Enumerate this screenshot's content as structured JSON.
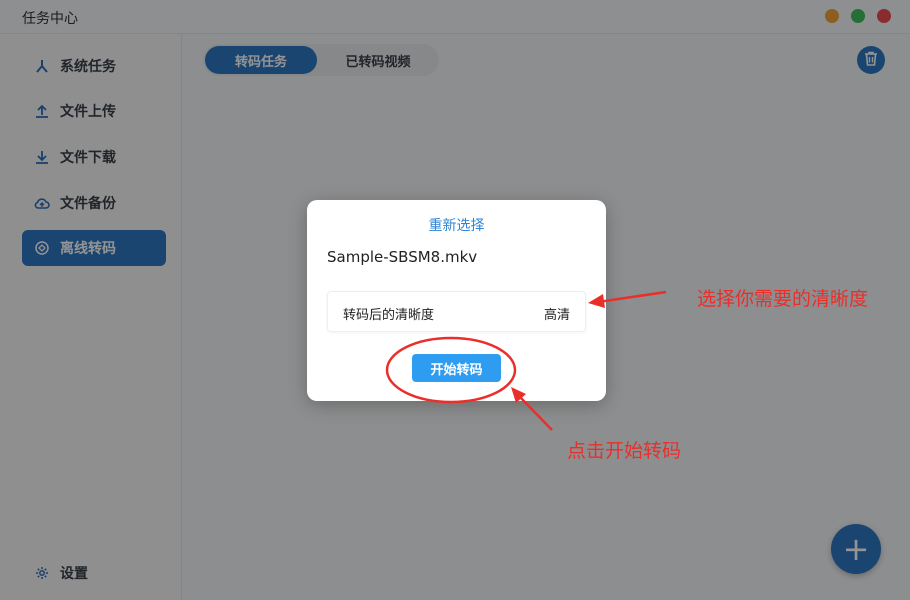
{
  "window": {
    "title": "任务中心"
  },
  "sidebar": {
    "items": [
      {
        "label": "系统任务",
        "icon": "branch-icon"
      },
      {
        "label": "文件上传",
        "icon": "upload-icon"
      },
      {
        "label": "文件下载",
        "icon": "download-icon"
      },
      {
        "label": "文件备份",
        "icon": "cloud-backup-icon"
      },
      {
        "label": "离线转码",
        "icon": "transcode-icon",
        "active": true
      }
    ],
    "settings_label": "设置"
  },
  "tabs": [
    {
      "label": "转码任务",
      "active": true
    },
    {
      "label": "已转码视频",
      "active": false
    }
  ],
  "dialog": {
    "reselect_label": "重新选择",
    "filename": "Sample-SBSM8.mkv",
    "quality_label": "转码后的清晰度",
    "quality_value": "高清",
    "start_button": "开始转码"
  },
  "annotations": {
    "quality_hint": "选择你需要的清晰度",
    "start_hint": "点击开始转码"
  },
  "colors": {
    "accent": "#2e78c2",
    "button": "#2e9cf0",
    "annotation": "#ea2f2b"
  }
}
